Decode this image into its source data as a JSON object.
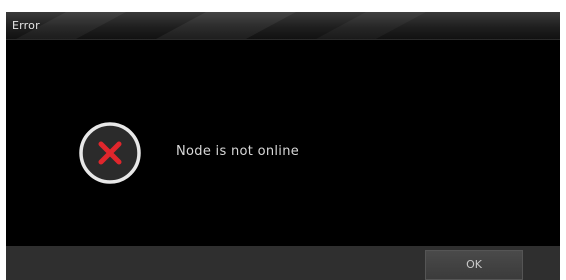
{
  "dialog": {
    "title": "Error",
    "message": "Node is not online",
    "icon": "error-x-icon",
    "ok_label": "OK"
  },
  "colors": {
    "background": "#000000",
    "titlebar": "#2a2a2a",
    "footer": "#2f2f2f",
    "icon_ring": "#e8e8e8",
    "icon_fill": "#2b2b2b",
    "icon_x": "#e0262c",
    "text": "#d8d8d8"
  }
}
